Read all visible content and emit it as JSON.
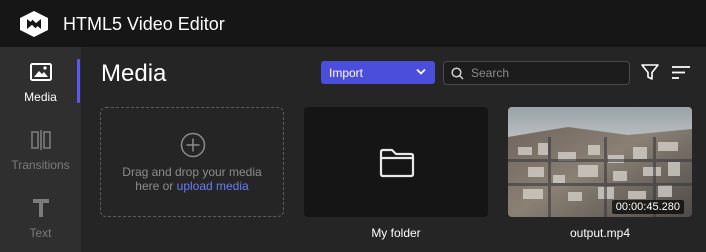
{
  "app": {
    "title": "HTML5 Video Editor",
    "logo_icon": "logo-icon"
  },
  "sidebar": {
    "items": [
      {
        "label": "Media",
        "icon": "image-icon",
        "active": true
      },
      {
        "label": "Transitions",
        "icon": "transitions-icon",
        "active": false
      },
      {
        "label": "Text",
        "icon": "text-icon",
        "active": false
      }
    ]
  },
  "main": {
    "title": "Media",
    "import_label": "Import",
    "search_placeholder": "Search",
    "dropzone": {
      "text_line1": "Drag and drop your media",
      "text_line2_prefix": "here or ",
      "link_text": "upload media"
    },
    "items": [
      {
        "type": "folder",
        "label": "My folder"
      },
      {
        "type": "video",
        "label": "output.mp4",
        "duration": "00:00:45.280"
      }
    ]
  },
  "colors": {
    "accent": "#4b4ddb",
    "link": "#6a7cf5",
    "titlebar": "#161616",
    "sidebar": "#2f2f2f",
    "background": "#252525"
  }
}
